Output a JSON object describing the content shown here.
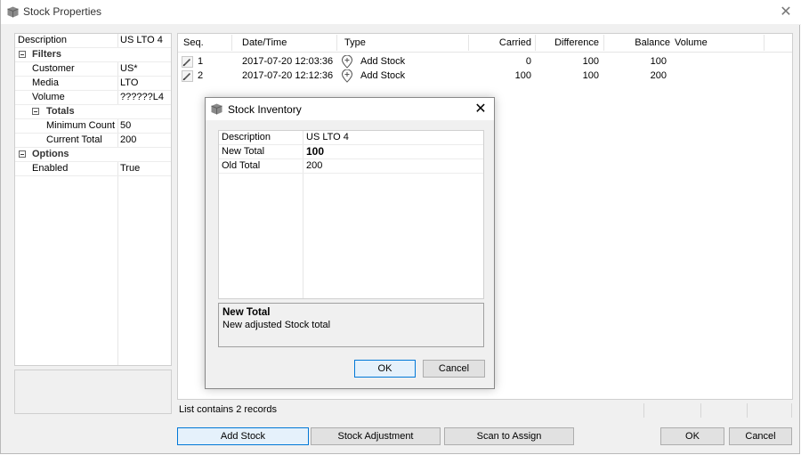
{
  "window": {
    "title": "Stock Properties",
    "close_glyph": "✕"
  },
  "properties": {
    "rows": [
      {
        "type": "prop",
        "indent": 0,
        "name": "Description",
        "value": "US LTO 4"
      },
      {
        "type": "cat",
        "indent": 0,
        "name": "Filters",
        "value": ""
      },
      {
        "type": "prop",
        "indent": 1,
        "name": "Customer",
        "value": "US*"
      },
      {
        "type": "prop",
        "indent": 1,
        "name": "Media",
        "value": "LTO"
      },
      {
        "type": "prop",
        "indent": 1,
        "name": "Volume",
        "value": "??????L4"
      },
      {
        "type": "cat",
        "indent": 1,
        "name": "Totals",
        "value": ""
      },
      {
        "type": "prop",
        "indent": 2,
        "name": "Minimum Count",
        "value": "50"
      },
      {
        "type": "prop",
        "indent": 2,
        "name": "Current Total",
        "value": "200"
      },
      {
        "type": "cat",
        "indent": 0,
        "name": "Options",
        "value": ""
      },
      {
        "type": "prop",
        "indent": 1,
        "name": "Enabled",
        "value": "True"
      }
    ]
  },
  "history": {
    "columns": [
      "Seq.",
      "Date/Time",
      "Type",
      "Carried",
      "Difference",
      "Balance",
      "Volume"
    ],
    "rows": [
      {
        "seq": "1",
        "datetime": "2017-07-20 12:03:36",
        "type": "Add Stock",
        "carried": "0",
        "difference": "100",
        "balance": "100",
        "volume": ""
      },
      {
        "seq": "2",
        "datetime": "2017-07-20 12:12:36",
        "type": "Add Stock",
        "carried": "100",
        "difference": "100",
        "balance": "200",
        "volume": ""
      }
    ]
  },
  "status": {
    "text": "List contains 2 records"
  },
  "buttons": {
    "add_stock": "Add Stock",
    "stock_adjustment": "Stock Adjustment",
    "scan_to_assign": "Scan to Assign",
    "ok": "OK",
    "cancel": "Cancel"
  },
  "dialog": {
    "title": "Stock Inventory",
    "close_glyph": "✕",
    "rows": [
      {
        "name": "Description",
        "value": "US LTO 4",
        "bold": false
      },
      {
        "name": "New Total",
        "value": "100",
        "bold": true
      },
      {
        "name": "Old Total",
        "value": "200",
        "bold": false
      }
    ],
    "help_title": "New Total",
    "help_text": "New adjusted Stock total",
    "ok": "OK",
    "cancel": "Cancel"
  },
  "colors": {
    "accent": "#0078d7",
    "panel": "#f0f0f0",
    "border": "#adadad"
  }
}
